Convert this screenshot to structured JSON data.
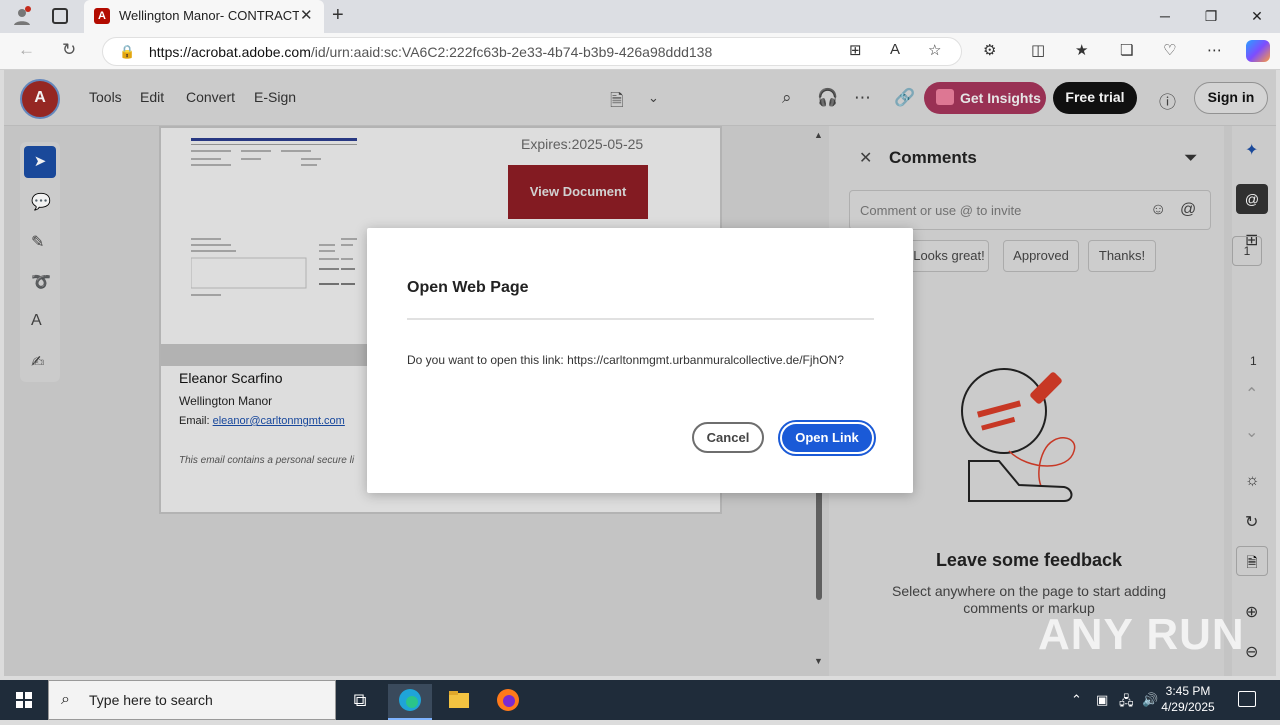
{
  "browser": {
    "tab_title": "Wellington Manor- CONTRACT F",
    "url_host": "https://acrobat.adobe.com",
    "url_path": "/id/urn:aaid:sc:VA6C2:222fc63b-2e33-4b74-b3b9-426a98ddd138"
  },
  "app": {
    "menu": [
      "Tools",
      "Edit",
      "Convert",
      "E-Sign"
    ],
    "get_insights": "Get Insights",
    "free_trial": "Free trial",
    "sign_in": "Sign in"
  },
  "document": {
    "expires": "Expires:2025-05-25",
    "view_button": "View Document",
    "name": "Eleanor Scarfino",
    "company": "Wellington Manor",
    "email_label": "Email: ",
    "email": "eleanor@carltonmgmt.com",
    "note": "This email contains a personal secure li"
  },
  "comments": {
    "title": "Comments",
    "placeholder": "Comment or use @ to invite",
    "chips": [
      "Looks great!",
      "Approved",
      "Thanks!"
    ],
    "feedback_title": "Leave some feedback",
    "feedback_text": "Select anywhere on the page to start adding comments or markup"
  },
  "pager": {
    "page_box": "1",
    "total": "1"
  },
  "dialog": {
    "title": "Open Web Page",
    "message": "Do you want to open this link: https://carltonmgmt.urbanmuralcollective.de/FjhON?",
    "cancel": "Cancel",
    "open_link": "Open Link"
  },
  "taskbar": {
    "search_placeholder": "Type here to search",
    "time": "3:45 PM",
    "date": "4/29/2025"
  },
  "watermark": "ANY RUN"
}
